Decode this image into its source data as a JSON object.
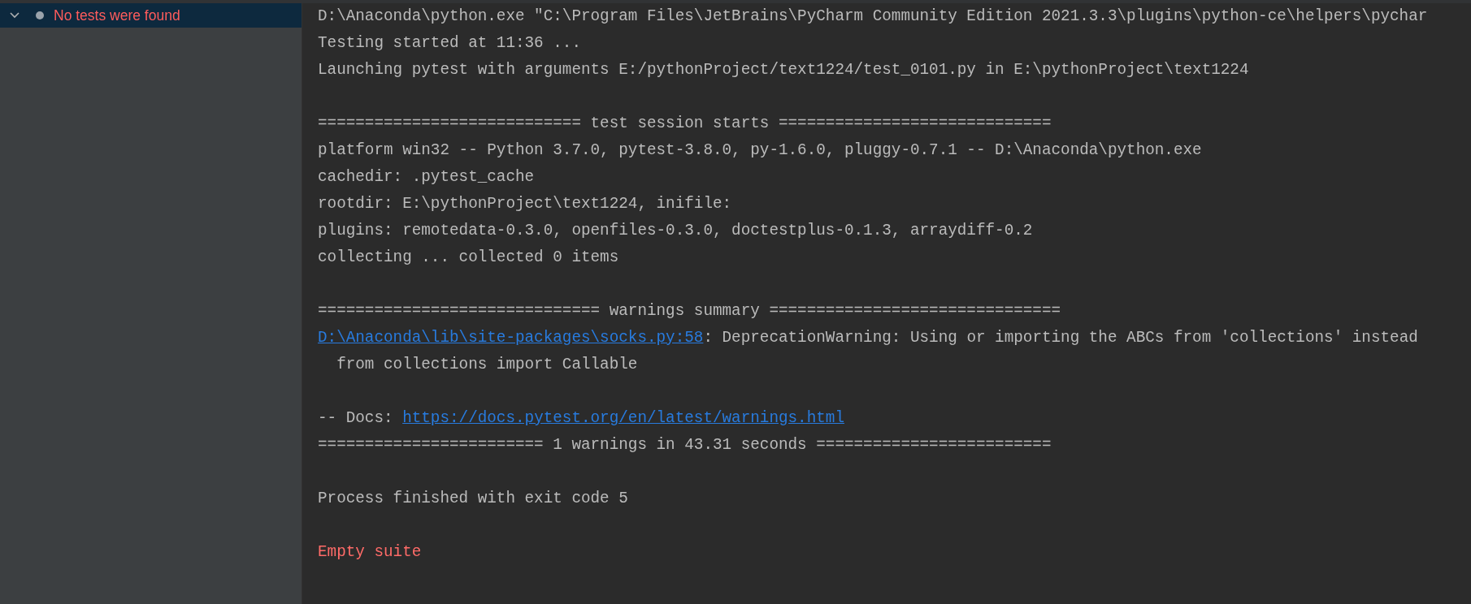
{
  "sidebar": {
    "items": [
      {
        "label": "No tests were found",
        "expanded": true,
        "selected": true
      }
    ]
  },
  "console": {
    "lines": [
      {
        "kind": "plain",
        "segments": [
          {
            "text": "D:\\Anaconda\\python.exe \"C:\\Program Files\\JetBrains\\PyCharm Community Edition 2021.3.3\\plugins\\python-ce\\helpers\\pychar",
            "link": false
          }
        ]
      },
      {
        "kind": "plain",
        "segments": [
          {
            "text": "Testing started at 11:36 ...",
            "link": false
          }
        ]
      },
      {
        "kind": "plain",
        "segments": [
          {
            "text": "Launching pytest with arguments E:/pythonProject/text1224/test_0101.py in E:\\pythonProject\\text1224",
            "link": false
          }
        ]
      },
      {
        "kind": "blank"
      },
      {
        "kind": "plain",
        "segments": [
          {
            "text": "============================ test session starts =============================",
            "link": false
          }
        ]
      },
      {
        "kind": "plain",
        "segments": [
          {
            "text": "platform win32 -- Python 3.7.0, pytest-3.8.0, py-1.6.0, pluggy-0.7.1 -- D:\\Anaconda\\python.exe",
            "link": false
          }
        ]
      },
      {
        "kind": "plain",
        "segments": [
          {
            "text": "cachedir: .pytest_cache",
            "link": false
          }
        ]
      },
      {
        "kind": "plain",
        "segments": [
          {
            "text": "rootdir: E:\\pythonProject\\text1224, inifile:",
            "link": false
          }
        ]
      },
      {
        "kind": "plain",
        "segments": [
          {
            "text": "plugins: remotedata-0.3.0, openfiles-0.3.0, doctestplus-0.1.3, arraydiff-0.2",
            "link": false
          }
        ]
      },
      {
        "kind": "plain",
        "segments": [
          {
            "text": "collecting ... collected 0 items",
            "link": false
          }
        ]
      },
      {
        "kind": "blank"
      },
      {
        "kind": "plain",
        "segments": [
          {
            "text": "============================== warnings summary ===============================",
            "link": false
          }
        ]
      },
      {
        "kind": "plain",
        "segments": [
          {
            "text": "D:\\Anaconda\\lib\\site-packages\\socks.py:58",
            "link": true
          },
          {
            "text": ": DeprecationWarning: Using or importing the ABCs from 'collections' instead",
            "link": false
          }
        ]
      },
      {
        "kind": "plain",
        "segments": [
          {
            "text": "  from collections import Callable",
            "link": false
          }
        ]
      },
      {
        "kind": "blank"
      },
      {
        "kind": "plain",
        "segments": [
          {
            "text": "-- Docs: ",
            "link": false
          },
          {
            "text": "https://docs.pytest.org/en/latest/warnings.html",
            "link": true
          }
        ]
      },
      {
        "kind": "plain",
        "segments": [
          {
            "text": "======================== 1 warnings in 43.31 seconds =========================",
            "link": false
          }
        ]
      },
      {
        "kind": "blank"
      },
      {
        "kind": "plain",
        "segments": [
          {
            "text": "Process finished with exit code 5",
            "link": false
          }
        ]
      },
      {
        "kind": "blank"
      },
      {
        "kind": "error",
        "segments": [
          {
            "text": "Empty suite",
            "link": false
          }
        ]
      }
    ]
  }
}
